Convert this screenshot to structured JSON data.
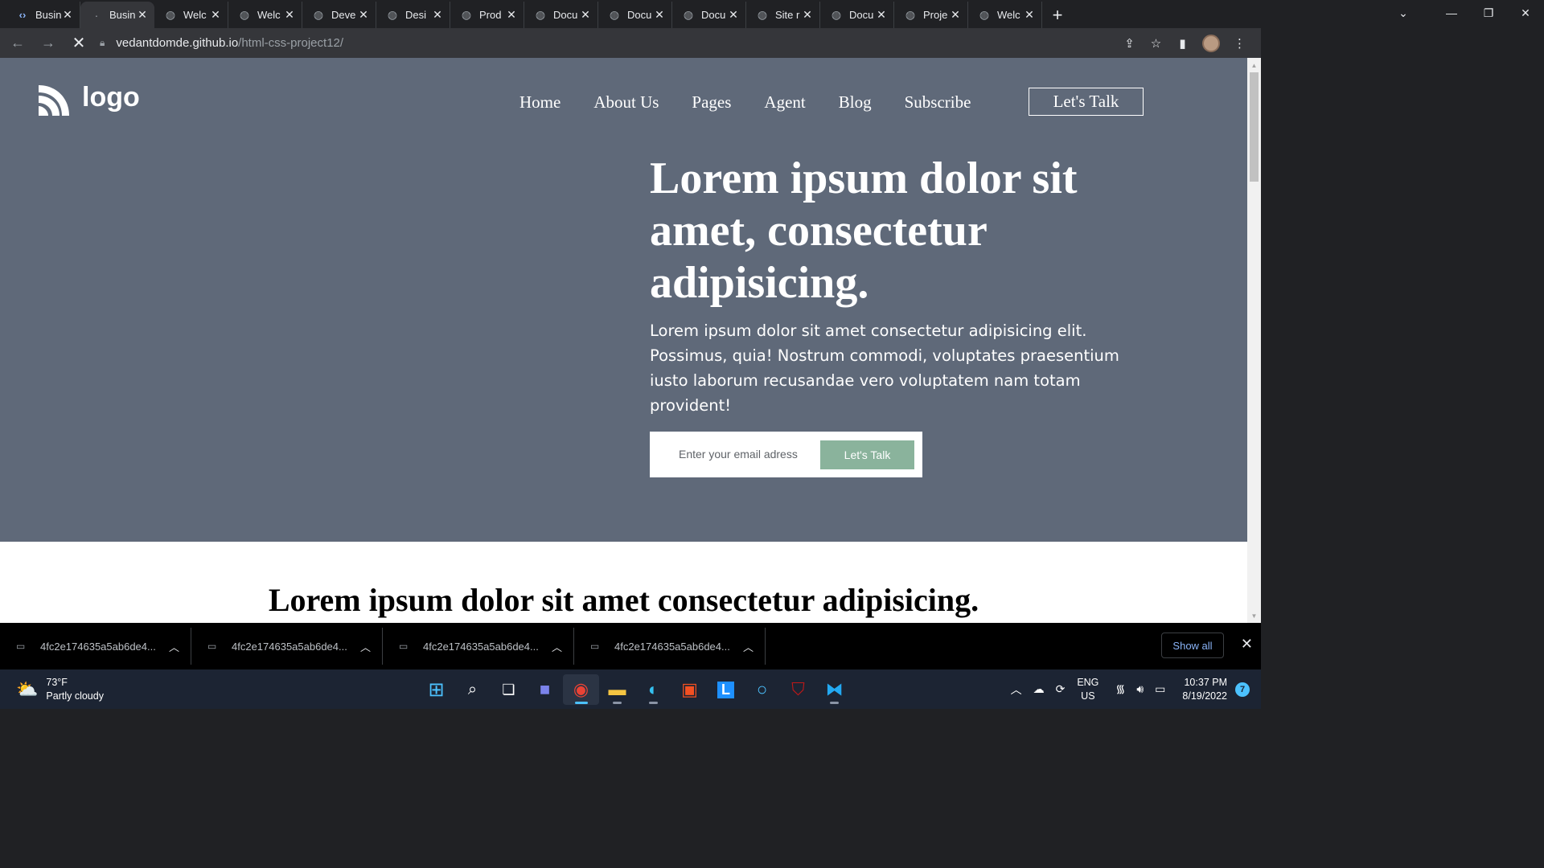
{
  "browser": {
    "tabs": [
      {
        "title": "Busin",
        "icon": "code-icon",
        "active": false
      },
      {
        "title": "Busin",
        "icon": "loading-icon",
        "active": true
      },
      {
        "title": "Welc",
        "icon": "globe-icon",
        "active": false
      },
      {
        "title": "Welc",
        "icon": "globe-icon",
        "active": false
      },
      {
        "title": "Deve",
        "icon": "globe-icon",
        "active": false
      },
      {
        "title": "Desi",
        "icon": "globe-icon",
        "active": false
      },
      {
        "title": "Prod",
        "icon": "globe-icon",
        "active": false
      },
      {
        "title": "Docu",
        "icon": "globe-icon",
        "active": false
      },
      {
        "title": "Docu",
        "icon": "globe-icon",
        "active": false
      },
      {
        "title": "Docu",
        "icon": "globe-icon",
        "active": false
      },
      {
        "title": "Site r",
        "icon": "globe-icon",
        "active": false
      },
      {
        "title": "Docu",
        "icon": "globe-icon",
        "active": false
      },
      {
        "title": "Proje",
        "icon": "globe-icon",
        "active": false
      },
      {
        "title": "Welc",
        "icon": "globe-icon",
        "active": false
      }
    ],
    "url_host": "vedantdomde.github.io",
    "url_path": "/html-css-project12/"
  },
  "page": {
    "logo_text": "logo",
    "nav": [
      "Home",
      "About Us",
      "Pages",
      "Agent",
      "Blog",
      "Subscribe"
    ],
    "cta_label": "Let's Talk",
    "hero_title": "Lorem ipsum dolor sit amet, consectetur adipisicing.",
    "hero_text": "Lorem ipsum dolor sit amet consectetur adipisicing elit. Possimus, quia! Nostrum commodi, voluptates praesentium iusto laborum recusandae vero voluptatem nam totam provident!",
    "email_placeholder": "Enter your email adress",
    "submit_label": "Let's Talk",
    "section_title": "Lorem ipsum dolor sit amet consectetur adipisicing.",
    "colors": {
      "hero_bg": "#5f6979",
      "accent": "#8ab39c"
    }
  },
  "downloads": {
    "items": [
      "4fc2e174635a5ab6de4...",
      "4fc2e174635a5ab6de4...",
      "4fc2e174635a5ab6de4...",
      "4fc2e174635a5ab6de4..."
    ],
    "show_all": "Show all"
  },
  "taskbar": {
    "temp": "73°F",
    "condition": "Partly cloudy",
    "lang_top": "ENG",
    "lang_bottom": "US",
    "time": "10:37 PM",
    "date": "8/19/2022",
    "notifications": "7"
  }
}
